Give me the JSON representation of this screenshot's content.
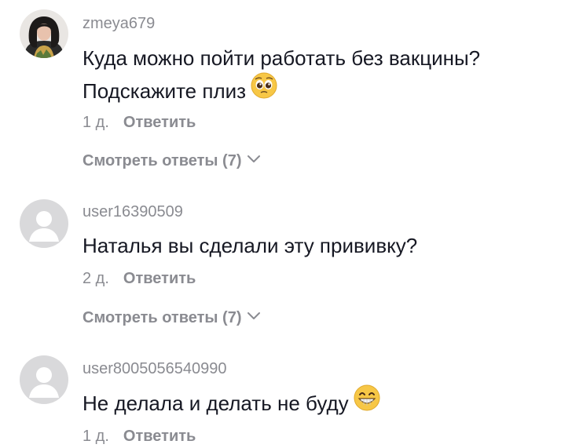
{
  "comments": [
    {
      "username": "zmeya679",
      "lines": [
        "Куда можно пойти работать без вакцины?",
        "Подскажите плиз"
      ],
      "emoji": "pleading-face-emoji",
      "time": "1 д.",
      "reply_label": "Ответить",
      "view_replies_label": "Смотреть ответы (7)",
      "avatar": "photo-avatar"
    },
    {
      "username": "user16390509",
      "lines": [
        "Наталья вы сделали эту прививку?"
      ],
      "time": "2 д.",
      "reply_label": "Ответить",
      "view_replies_label": "Смотреть ответы (7)",
      "avatar": "default-avatar"
    },
    {
      "username": "user8005056540990",
      "lines": [
        "Не делала и делать не буду"
      ],
      "emoji": "grinning-face-emoji",
      "time": "1 д.",
      "reply_label": "Ответить",
      "avatar": "default-avatar"
    }
  ],
  "colors": {
    "text": "#161823",
    "secondary": "#8a8b91",
    "avatar_placeholder": "#d9d9db",
    "emoji_yellow": "#f7c746"
  }
}
